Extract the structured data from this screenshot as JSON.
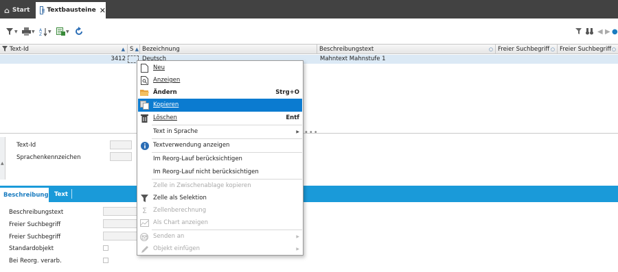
{
  "tabs": {
    "start_label": "Start",
    "active_label": "Textbausteine",
    "close_glyph": "✕"
  },
  "toolbar": {
    "icons": [
      "filter-icon",
      "print-icon",
      "sort-az-icon",
      "export-excel-icon",
      "refresh-icon"
    ],
    "right_icons": [
      "filter-clear-icon",
      "binoculars-icon",
      "nav-left-icon",
      "nav-right-icon",
      "dot-icon"
    ]
  },
  "grid": {
    "columns": [
      {
        "label": "Text-Id"
      },
      {
        "label": "S"
      },
      {
        "label": "Bezeichnung"
      },
      {
        "label": "Beschreibungstext"
      },
      {
        "label": "Freier Suchbegriff"
      },
      {
        "label": "Freier Suchbegriff"
      }
    ],
    "row": {
      "text_id": "3412",
      "bezeichnung": "Deutsch",
      "beschreibung": "Mahntext Mahnstufe 1"
    }
  },
  "detail": {
    "text_id_label": "Text-Id",
    "sprache_label": "Sprachenkennzeichen"
  },
  "bottom_tabs": [
    {
      "label": "Beschreibung"
    },
    {
      "label": "Text"
    }
  ],
  "bottom_fields": {
    "beschreibungstext": "Beschreibungstext",
    "suchbegriff1": "Freier Suchbegriff",
    "suchbegriff2": "Freier Suchbegriff",
    "standardobjekt": "Standardobjekt",
    "reorg": "Bei Reorg. verarb."
  },
  "context_menu": {
    "items": [
      {
        "label": "Neu",
        "icon": "new-document-icon"
      },
      {
        "label": "Anzeigen",
        "icon": "view-document-icon"
      },
      {
        "label": "Ändern",
        "icon": "folder-open-icon",
        "shortcut": "Strg+O"
      },
      {
        "label": "Kopieren",
        "icon": "copy-icon"
      },
      {
        "label": "Löschen",
        "icon": "trash-icon",
        "shortcut": "Entf"
      },
      {
        "label": "Text in Sprache",
        "submenu": true
      },
      {
        "label": "Textverwendung anzeigen",
        "icon": "info-icon"
      },
      {
        "label": "Im Reorg-Lauf berücksichtigen"
      },
      {
        "label": "Im Reorg-Lauf nicht berücksichtigen"
      },
      {
        "label": "Zelle in Zwischenablage kopieren"
      },
      {
        "label": "Zelle als Selektion",
        "icon": "filter-icon"
      },
      {
        "label": "Zellenberechnung",
        "icon": "sigma-icon"
      },
      {
        "label": "Als Chart anzeigen",
        "icon": "chart-icon"
      },
      {
        "label": "Senden an",
        "icon": "send-icon",
        "submenu": true
      },
      {
        "label": "Objekt einfügen",
        "icon": "pencil-icon",
        "submenu": true
      }
    ]
  },
  "colors": {
    "tabbar": "#424242",
    "accent": "#1a9ad9",
    "highlight": "#0b7bd0",
    "selected_row": "#dbe9f5"
  }
}
